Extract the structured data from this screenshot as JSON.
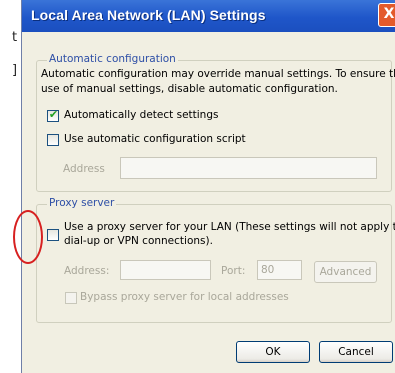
{
  "background": {
    "lines": [
      "t",
      "]"
    ]
  },
  "window": {
    "title": "Local Area Network (LAN) Settings",
    "close_glyph": "X"
  },
  "auto_config": {
    "legend": "Automatic configuration",
    "description_line1": "Automatic configuration may override manual settings.  To ensure the",
    "description_line2": "use of manual settings, disable automatic configuration.",
    "detect_label": "Automatically detect settings",
    "detect_checked": true,
    "script_label": "Use automatic configuration script",
    "script_checked": false,
    "address_label": "Address",
    "address_value": ""
  },
  "proxy": {
    "legend": "Proxy server",
    "use_proxy_line1": "Use a proxy server for your LAN (These settings will not apply to",
    "use_proxy_line2": "dial-up or VPN connections).",
    "use_proxy_checked": false,
    "address_label": "Address:",
    "address_value": "",
    "port_label": "Port:",
    "port_value": "80",
    "advanced_label": "Advanced",
    "bypass_label": "Bypass proxy server for local addresses",
    "bypass_checked": false
  },
  "buttons": {
    "ok_label": "OK",
    "cancel_label": "Cancel"
  },
  "colors": {
    "titlebar": "#1f56c9",
    "legend": "#2e4fa6",
    "annotation_circle": "#d72020",
    "check": "#21a121"
  }
}
